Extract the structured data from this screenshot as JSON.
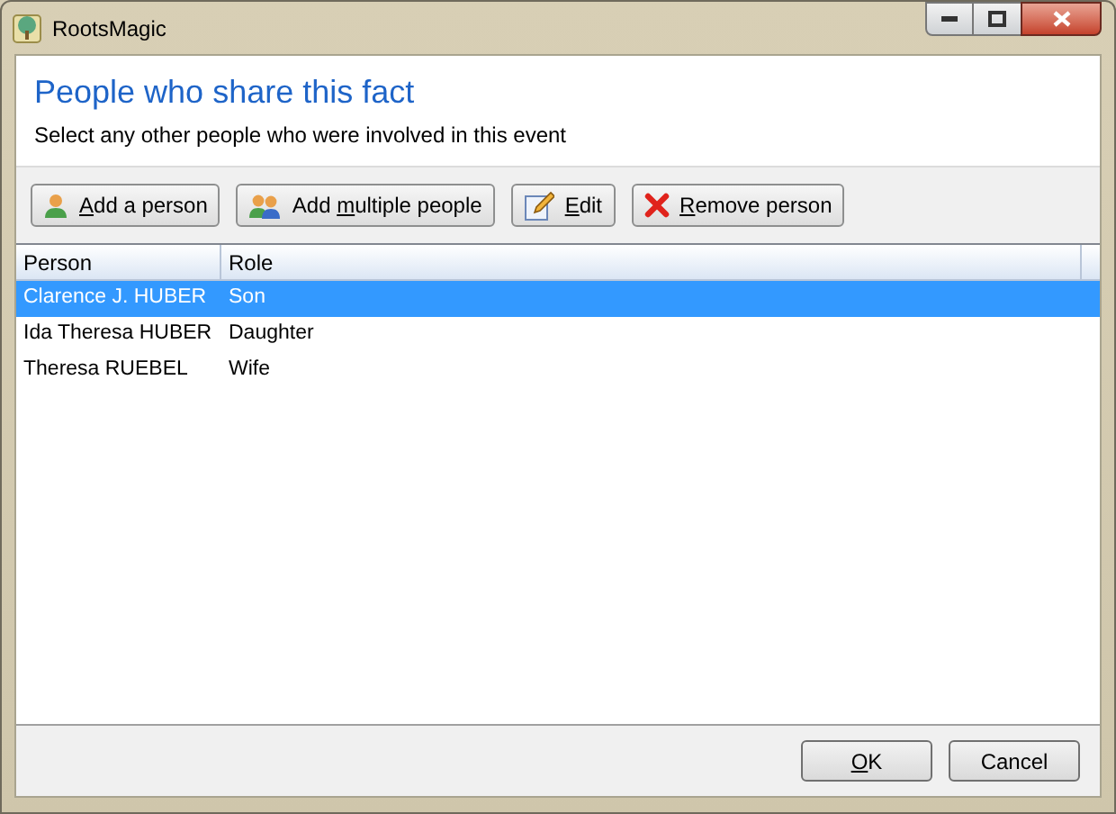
{
  "window": {
    "title": "RootsMagic"
  },
  "header": {
    "title": "People who share this fact",
    "subtitle": "Select any other people who were involved in this event"
  },
  "toolbar": [
    {
      "kind": "person",
      "mnemonic": "A",
      "after": "dd a person"
    },
    {
      "kind": "people",
      "before": "Add ",
      "mnemonic": "m",
      "after": "ultiple people"
    },
    {
      "kind": "edit",
      "mnemonic": "E",
      "after": "dit"
    },
    {
      "kind": "remove",
      "mnemonic": "R",
      "after": "emove person"
    }
  ],
  "table": {
    "columns": [
      "Person",
      "Role"
    ],
    "rows": [
      {
        "person": "Clarence J. HUBER",
        "role": "Son",
        "selected": true
      },
      {
        "person": "Ida Theresa HUBER",
        "role": "Daughter",
        "selected": false
      },
      {
        "person": "Theresa RUEBEL",
        "role": "Wife",
        "selected": false
      }
    ]
  },
  "buttons": [
    {
      "mnemonic": "O",
      "after": "K"
    },
    {
      "before": "Cancel"
    }
  ]
}
